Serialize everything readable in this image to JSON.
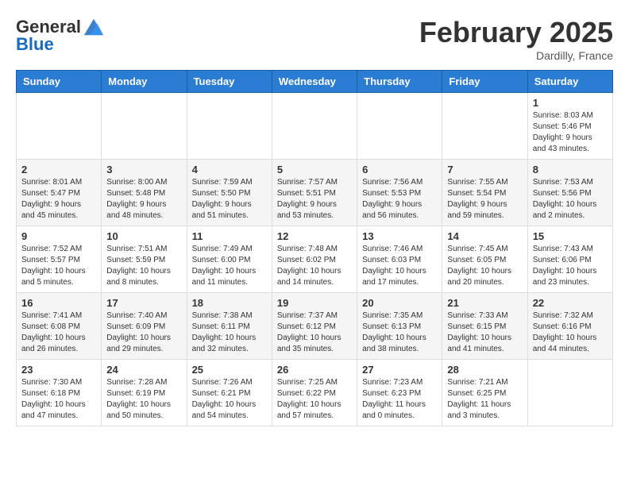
{
  "header": {
    "logo_general": "General",
    "logo_blue": "Blue",
    "month_title": "February 2025",
    "location": "Dardilly, France"
  },
  "weekdays": [
    "Sunday",
    "Monday",
    "Tuesday",
    "Wednesday",
    "Thursday",
    "Friday",
    "Saturday"
  ],
  "weeks": [
    [
      {
        "day": "",
        "info": ""
      },
      {
        "day": "",
        "info": ""
      },
      {
        "day": "",
        "info": ""
      },
      {
        "day": "",
        "info": ""
      },
      {
        "day": "",
        "info": ""
      },
      {
        "day": "",
        "info": ""
      },
      {
        "day": "1",
        "info": "Sunrise: 8:03 AM\nSunset: 5:46 PM\nDaylight: 9 hours and 43 minutes."
      }
    ],
    [
      {
        "day": "2",
        "info": "Sunrise: 8:01 AM\nSunset: 5:47 PM\nDaylight: 9 hours and 45 minutes."
      },
      {
        "day": "3",
        "info": "Sunrise: 8:00 AM\nSunset: 5:48 PM\nDaylight: 9 hours and 48 minutes."
      },
      {
        "day": "4",
        "info": "Sunrise: 7:59 AM\nSunset: 5:50 PM\nDaylight: 9 hours and 51 minutes."
      },
      {
        "day": "5",
        "info": "Sunrise: 7:57 AM\nSunset: 5:51 PM\nDaylight: 9 hours and 53 minutes."
      },
      {
        "day": "6",
        "info": "Sunrise: 7:56 AM\nSunset: 5:53 PM\nDaylight: 9 hours and 56 minutes."
      },
      {
        "day": "7",
        "info": "Sunrise: 7:55 AM\nSunset: 5:54 PM\nDaylight: 9 hours and 59 minutes."
      },
      {
        "day": "8",
        "info": "Sunrise: 7:53 AM\nSunset: 5:56 PM\nDaylight: 10 hours and 2 minutes."
      }
    ],
    [
      {
        "day": "9",
        "info": "Sunrise: 7:52 AM\nSunset: 5:57 PM\nDaylight: 10 hours and 5 minutes."
      },
      {
        "day": "10",
        "info": "Sunrise: 7:51 AM\nSunset: 5:59 PM\nDaylight: 10 hours and 8 minutes."
      },
      {
        "day": "11",
        "info": "Sunrise: 7:49 AM\nSunset: 6:00 PM\nDaylight: 10 hours and 11 minutes."
      },
      {
        "day": "12",
        "info": "Sunrise: 7:48 AM\nSunset: 6:02 PM\nDaylight: 10 hours and 14 minutes."
      },
      {
        "day": "13",
        "info": "Sunrise: 7:46 AM\nSunset: 6:03 PM\nDaylight: 10 hours and 17 minutes."
      },
      {
        "day": "14",
        "info": "Sunrise: 7:45 AM\nSunset: 6:05 PM\nDaylight: 10 hours and 20 minutes."
      },
      {
        "day": "15",
        "info": "Sunrise: 7:43 AM\nSunset: 6:06 PM\nDaylight: 10 hours and 23 minutes."
      }
    ],
    [
      {
        "day": "16",
        "info": "Sunrise: 7:41 AM\nSunset: 6:08 PM\nDaylight: 10 hours and 26 minutes."
      },
      {
        "day": "17",
        "info": "Sunrise: 7:40 AM\nSunset: 6:09 PM\nDaylight: 10 hours and 29 minutes."
      },
      {
        "day": "18",
        "info": "Sunrise: 7:38 AM\nSunset: 6:11 PM\nDaylight: 10 hours and 32 minutes."
      },
      {
        "day": "19",
        "info": "Sunrise: 7:37 AM\nSunset: 6:12 PM\nDaylight: 10 hours and 35 minutes."
      },
      {
        "day": "20",
        "info": "Sunrise: 7:35 AM\nSunset: 6:13 PM\nDaylight: 10 hours and 38 minutes."
      },
      {
        "day": "21",
        "info": "Sunrise: 7:33 AM\nSunset: 6:15 PM\nDaylight: 10 hours and 41 minutes."
      },
      {
        "day": "22",
        "info": "Sunrise: 7:32 AM\nSunset: 6:16 PM\nDaylight: 10 hours and 44 minutes."
      }
    ],
    [
      {
        "day": "23",
        "info": "Sunrise: 7:30 AM\nSunset: 6:18 PM\nDaylight: 10 hours and 47 minutes."
      },
      {
        "day": "24",
        "info": "Sunrise: 7:28 AM\nSunset: 6:19 PM\nDaylight: 10 hours and 50 minutes."
      },
      {
        "day": "25",
        "info": "Sunrise: 7:26 AM\nSunset: 6:21 PM\nDaylight: 10 hours and 54 minutes."
      },
      {
        "day": "26",
        "info": "Sunrise: 7:25 AM\nSunset: 6:22 PM\nDaylight: 10 hours and 57 minutes."
      },
      {
        "day": "27",
        "info": "Sunrise: 7:23 AM\nSunset: 6:23 PM\nDaylight: 11 hours and 0 minutes."
      },
      {
        "day": "28",
        "info": "Sunrise: 7:21 AM\nSunset: 6:25 PM\nDaylight: 11 hours and 3 minutes."
      },
      {
        "day": "",
        "info": ""
      }
    ]
  ]
}
